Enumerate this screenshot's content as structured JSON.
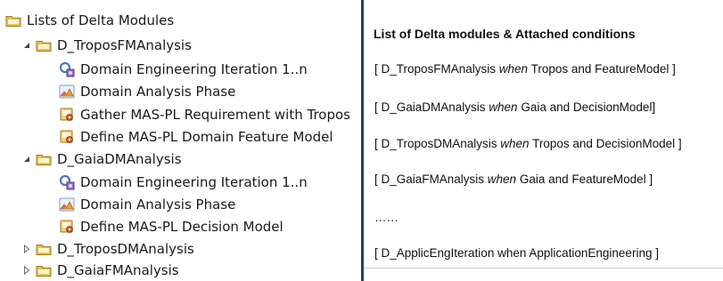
{
  "tree": {
    "items": [
      {
        "label": "Lists of Delta Modules",
        "icon": "folder-icon",
        "toggle": ""
      },
      {
        "label": "D_TroposFMAnalysis",
        "icon": "folder-icon",
        "toggle": "expanded"
      },
      {
        "label": "Domain Engineering Iteration 1..n",
        "icon": "iteration-icon",
        "toggle": ""
      },
      {
        "label": "Domain Analysis Phase",
        "icon": "phase-icon",
        "toggle": ""
      },
      {
        "label": "Gather MAS-PL Requirement with Tropos",
        "icon": "task-icon",
        "toggle": ""
      },
      {
        "label": "Define MAS-PL Domain Feature Model",
        "icon": "task-icon",
        "toggle": ""
      },
      {
        "label": "D_GaiaDMAnalysis",
        "icon": "folder-icon",
        "toggle": "expanded"
      },
      {
        "label": "Domain Engineering Iteration 1..n",
        "icon": "iteration-icon",
        "toggle": ""
      },
      {
        "label": "Domain Analysis Phase",
        "icon": "phase-icon",
        "toggle": ""
      },
      {
        "label": "Define MAS-PL Decision Model",
        "icon": "task-icon",
        "toggle": ""
      },
      {
        "label": "D_TroposDMAnalysis",
        "icon": "folder-icon",
        "toggle": "collapsed"
      },
      {
        "label": "D_GaiaFMAnalysis",
        "icon": "folder-icon",
        "toggle": "collapsed"
      }
    ]
  },
  "panel": {
    "title": "List of Delta modules & Attached conditions",
    "conditions": [
      {
        "pre": "[ D_TroposFMAnalysis ",
        "kw": "when",
        "post": " Tropos and FeatureModel ]"
      },
      {
        "pre": "[ D_GaiaDMAnalysis ",
        "kw": "when",
        "post": " Gaia and DecisionModel]"
      },
      {
        "pre": "[ D_TroposDMAnalysis ",
        "kw": "when",
        "post": " Tropos and DecisionModel ]"
      },
      {
        "pre": "[ D_GaiaFMAnalysis ",
        "kw": "when",
        "post": " Gaia and FeatureModel ]"
      },
      {
        "pre": "……",
        "kw": "",
        "post": ""
      },
      {
        "pre": "[ D_ApplicEngIteration  when ApplicationEngineering ]",
        "kw": "",
        "post": ""
      }
    ]
  }
}
